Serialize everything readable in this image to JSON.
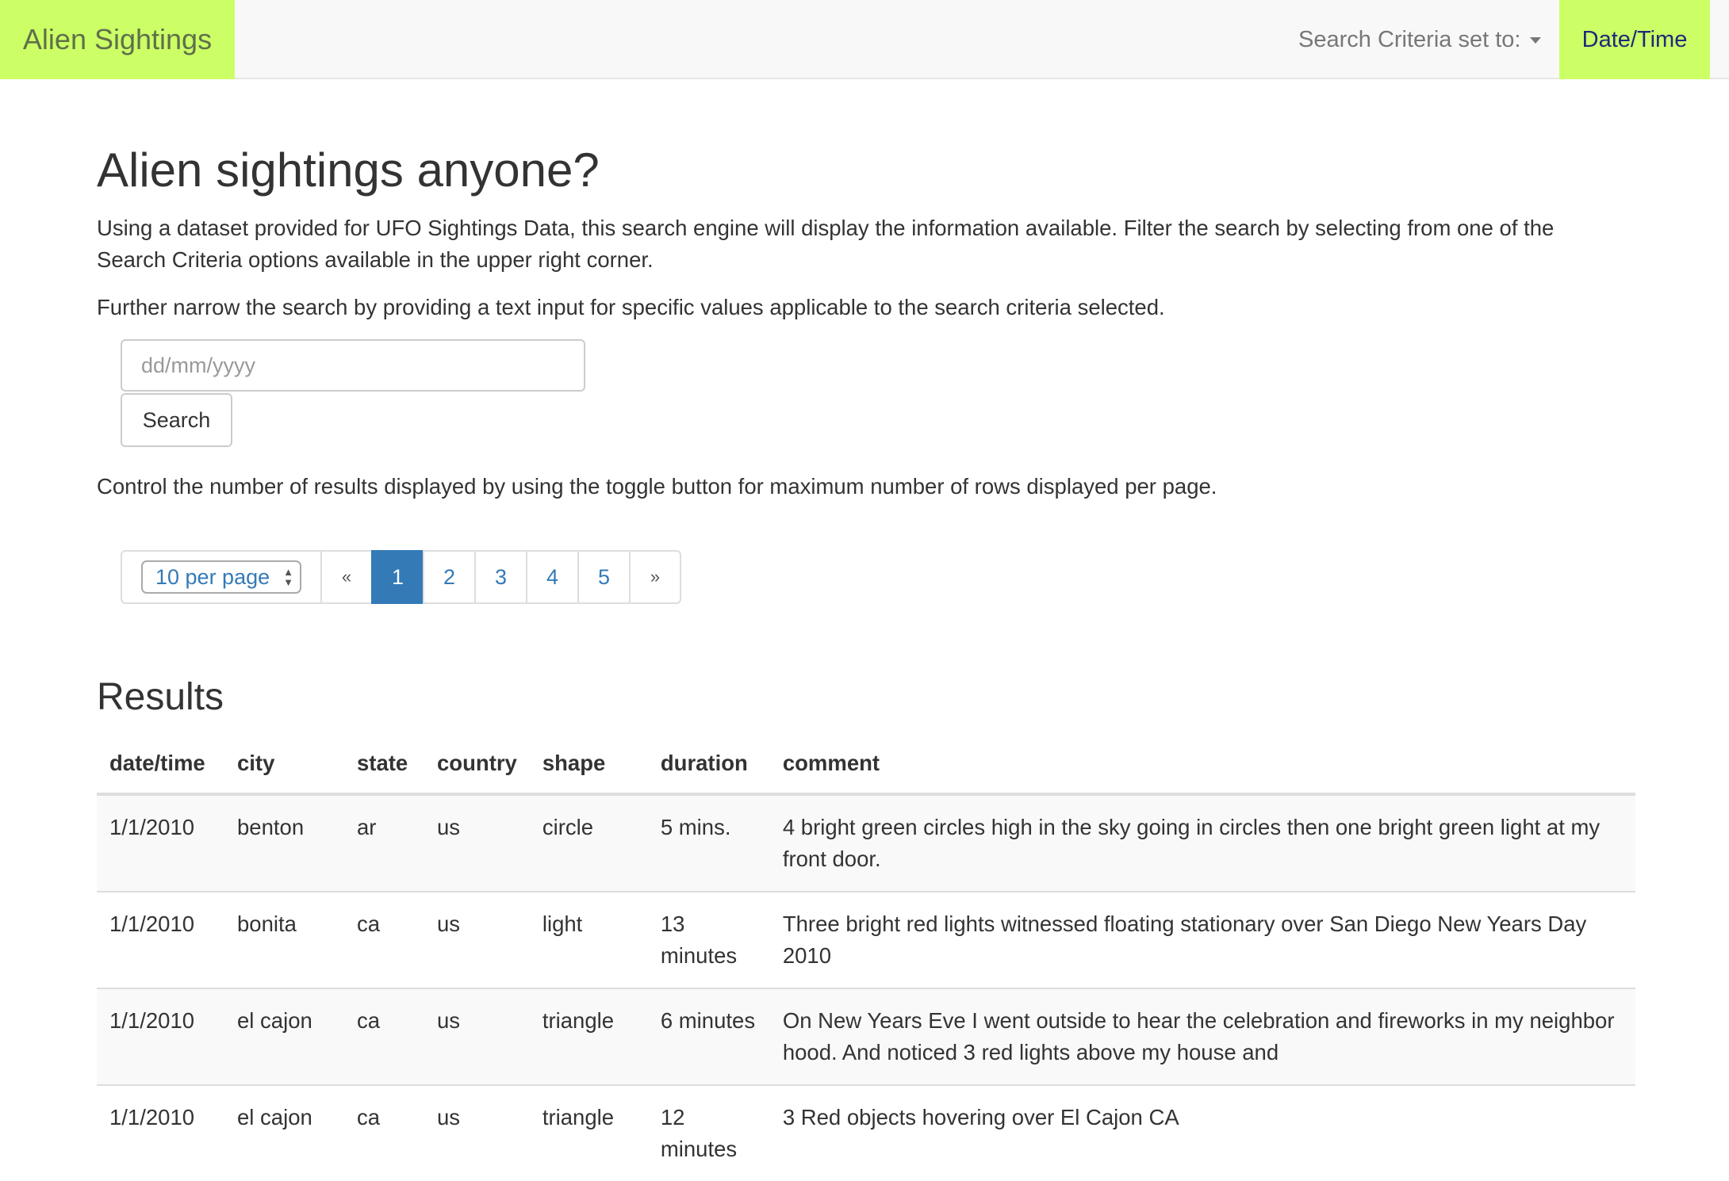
{
  "navbar": {
    "brand": "Alien Sightings",
    "criteria_label": "Search Criteria set to:",
    "criteria_value": "Date/Time"
  },
  "main": {
    "heading": "Alien sightings anyone?",
    "intro": "Using a dataset provided for UFO Sightings Data, this search engine will display the information available. Filter the search by selecting from one of the Search Criteria options available in the upper right corner.",
    "narrow": "Further narrow the search by providing a text input for specific values applicable to the search criteria selected.",
    "control": "Control the number of results displayed by using the toggle button for maximum number of rows displayed per page."
  },
  "search": {
    "placeholder": "dd/mm/yyyy",
    "value": "",
    "button_label": "Search"
  },
  "pagination": {
    "per_page": "10 per page",
    "prev": "«",
    "next": "»",
    "pages": [
      "1",
      "2",
      "3",
      "4",
      "5"
    ],
    "current_page": "1"
  },
  "results": {
    "heading": "Results",
    "columns": [
      "date/time",
      "city",
      "state",
      "country",
      "shape",
      "duration",
      "comment"
    ],
    "rows": [
      [
        "1/1/2010",
        "benton",
        "ar",
        "us",
        "circle",
        "5 mins.",
        "4 bright green circles high in the sky going in circles then one bright green light at my front door."
      ],
      [
        "1/1/2010",
        "bonita",
        "ca",
        "us",
        "light",
        "13 minutes",
        "Three bright red lights witnessed floating stationary over San Diego New Years Day 2010"
      ],
      [
        "1/1/2010",
        "el cajon",
        "ca",
        "us",
        "triangle",
        "6 minutes",
        "On New Years Eve I went outside to hear the celebration and fireworks in my neighbor hood. And noticed 3 red lights above my house and"
      ],
      [
        "1/1/2010",
        "el cajon",
        "ca",
        "us",
        "triangle",
        "12 minutes",
        "3 Red objects hovering over El Cajon CA"
      ]
    ]
  },
  "colors": {
    "brand_bg": "#ccff66",
    "link": "#337ab7",
    "active_page": "#337ab7"
  }
}
